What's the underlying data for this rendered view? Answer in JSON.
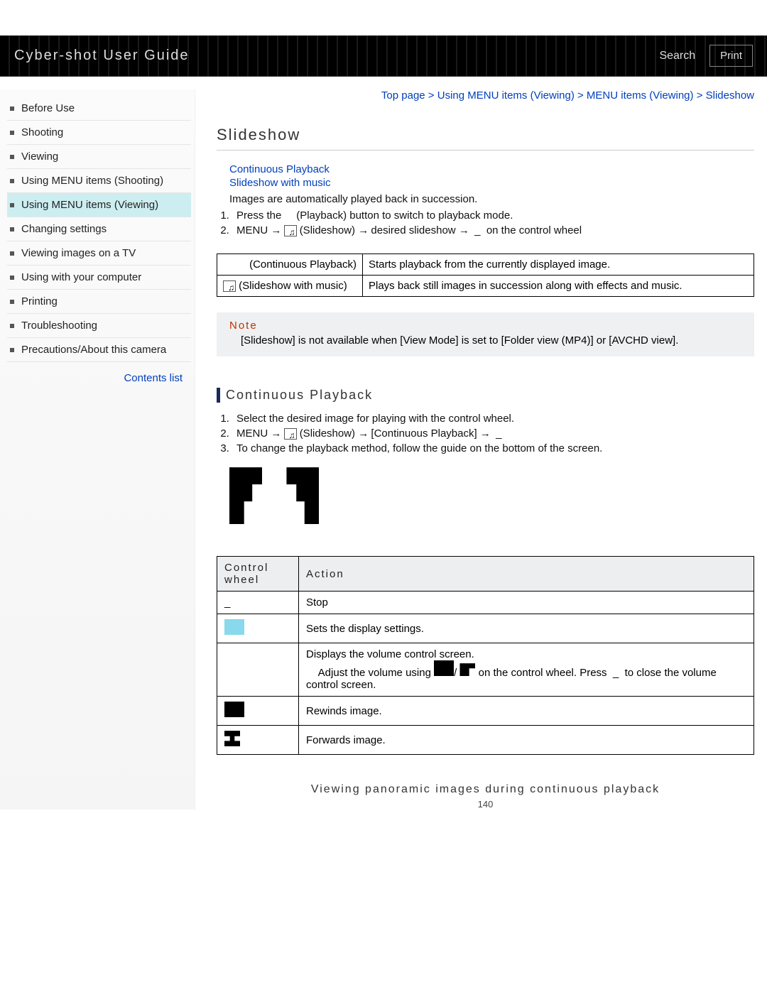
{
  "header": {
    "title": "Cyber-shot User Guide",
    "search": "Search",
    "print": "Print"
  },
  "breadcrumbs": "Top page > Using MENU items (Viewing) > MENU items (Viewing) > Slideshow",
  "sidebar": {
    "items": [
      {
        "label": "Before Use"
      },
      {
        "label": "Shooting"
      },
      {
        "label": "Viewing"
      },
      {
        "label": "Using MENU items (Shooting)"
      },
      {
        "label": "Using MENU items (Viewing)",
        "active": true
      },
      {
        "label": "Changing settings"
      },
      {
        "label": "Viewing images on a TV"
      },
      {
        "label": "Using with your computer"
      },
      {
        "label": "Printing"
      },
      {
        "label": "Troubleshooting"
      },
      {
        "label": "Precautions/About this camera"
      }
    ],
    "contents_list": "Contents list"
  },
  "page": {
    "title": "Slideshow",
    "anchors": {
      "a1": "Continuous Playback",
      "a2": "Slideshow with music"
    },
    "intro": "Images are automatically played back in succession.",
    "steps": {
      "s1a": "Press the",
      "s1b": "(Playback) button to switch to playback mode.",
      "s2a": "MENU",
      "s2b": "(Slideshow)",
      "s2c": "desired slideshow",
      "s2d": "on the control wheel"
    },
    "modes": {
      "r1a": "(Continuous Playback)",
      "r1b": "Starts playback from the currently displayed image.",
      "r2a": "(Slideshow with music)",
      "r2b": "Plays back still images in succession along with effects and music."
    },
    "note": {
      "title": "Note",
      "text": "[Slideshow] is not available when [View Mode] is set to [Folder view (MP4)] or [AVCHD view]."
    },
    "cp": {
      "title": "Continuous Playback",
      "s1": "Select the desired image for playing with the control wheel.",
      "s2a": "MENU",
      "s2b": "(Slideshow)",
      "s2c": "[Continuous Playback]",
      "s3": "To change the playback method, follow the guide on the bottom of the screen."
    },
    "ctrl": {
      "h1": "Control wheel",
      "h2": "Action",
      "r1b": "Stop",
      "r2b": "Sets the display settings.",
      "r3a": "Displays the volume control screen.",
      "r3b": "Adjust the volume using",
      "r3c": "/",
      "r3d": "on the control wheel. Press",
      "r3e": "to close the volume control screen.",
      "r4b": "Rewinds image.",
      "r5b": "Forwards image."
    },
    "footer": "Viewing panoramic images during continuous playback",
    "page_num": "140"
  }
}
